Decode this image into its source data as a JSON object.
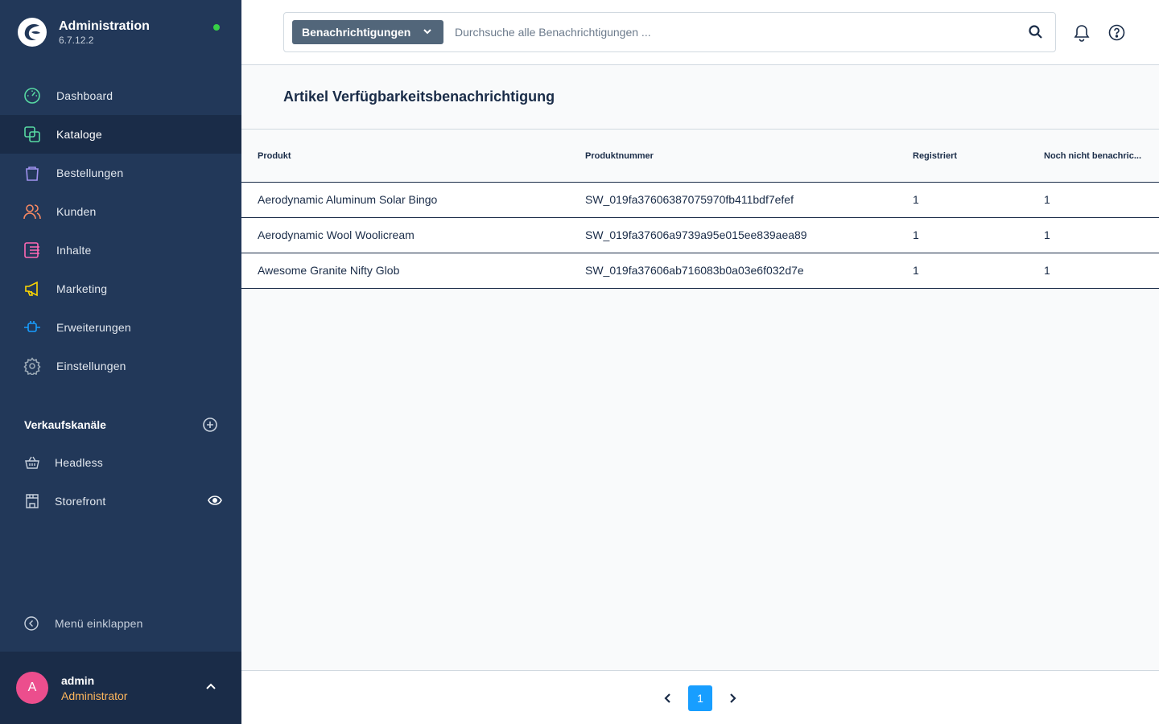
{
  "brand": {
    "title": "Administration",
    "version": "6.7.12.2"
  },
  "nav": [
    {
      "label": "Dashboard",
      "icon": "dashboard-icon",
      "color": "#57d9a3"
    },
    {
      "label": "Kataloge",
      "icon": "catalog-icon",
      "color": "#57d9a3",
      "active": true
    },
    {
      "label": "Bestellungen",
      "icon": "orders-icon",
      "color": "#a092f0"
    },
    {
      "label": "Kunden",
      "icon": "customers-icon",
      "color": "#f88962"
    },
    {
      "label": "Inhalte",
      "icon": "content-icon",
      "color": "#ff68b4"
    },
    {
      "label": "Marketing",
      "icon": "marketing-icon",
      "color": "#ffd700"
    },
    {
      "label": "Erweiterungen",
      "icon": "extensions-icon",
      "color": "#189eff"
    },
    {
      "label": "Einstellungen",
      "icon": "settings-icon",
      "color": "#9aa8b5"
    }
  ],
  "sales_channels": {
    "title": "Verkaufskanäle",
    "items": [
      {
        "label": "Headless",
        "icon": "basket-icon"
      },
      {
        "label": "Storefront",
        "icon": "storefront-icon"
      }
    ]
  },
  "collapse_label": "Menü einklappen",
  "user": {
    "initial": "A",
    "name": "admin",
    "role": "Administrator"
  },
  "search": {
    "type_label": "Benachrichtigungen",
    "placeholder": "Durchsuche alle Benachrichtigungen ..."
  },
  "page_title": "Artikel Verfügbarkeitsbenachrichtigung",
  "table": {
    "columns": [
      "Produkt",
      "Produktnummer",
      "Registriert",
      "Noch nicht benachric..."
    ],
    "rows": [
      [
        "Aerodynamic Aluminum Solar Bingo",
        "SW_019fa37606387075970fb411bdf7efef",
        "1",
        "1"
      ],
      [
        "Aerodynamic Wool Woolicream",
        "SW_019fa37606a9739a95e015ee839aea89",
        "1",
        "1"
      ],
      [
        "Awesome Granite Nifty Glob",
        "SW_019fa37606ab716083b0a03e6f032d7e",
        "1",
        "1"
      ]
    ]
  },
  "pagination": {
    "current": "1"
  },
  "colors": {
    "sidebar": "#223859",
    "active": "#1a2c48",
    "accent": "#189eff",
    "online": "#37d046"
  }
}
